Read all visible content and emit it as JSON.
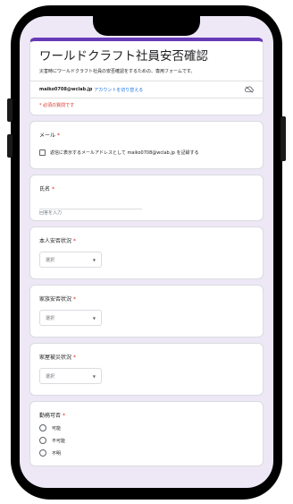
{
  "header": {
    "title": "ワールドクラフト社員安否確認",
    "description": "災害時にワールドクラフト社員の安否確認をするための、専用フォームです。",
    "account_email": "maiko0708@wclab.jp",
    "switch_account": "アカウントを切り替える",
    "required_note": "* 必須の質問です",
    "accent_color": "#673ab7",
    "cloud_icon": "cloud-off-icon"
  },
  "questions": {
    "email": {
      "label": "メール",
      "required": "*",
      "checkbox_label": "返信に表示するメールアドレスとして maiko0708@wclab.jp を記録する"
    },
    "name": {
      "label": "氏名",
      "required": "*",
      "placeholder": "回答を入力"
    },
    "self_status": {
      "label": "本人安否状況",
      "required": "*",
      "select_value": "選択"
    },
    "family_status": {
      "label": "家族安否状況",
      "required": "*",
      "select_value": "選択"
    },
    "house_damage": {
      "label": "家屋被災状況",
      "required": "*",
      "select_value": "選択"
    },
    "work_availability": {
      "label": "勤務可否",
      "required": "*",
      "options": [
        "可能",
        "不可能",
        "不明"
      ]
    }
  }
}
